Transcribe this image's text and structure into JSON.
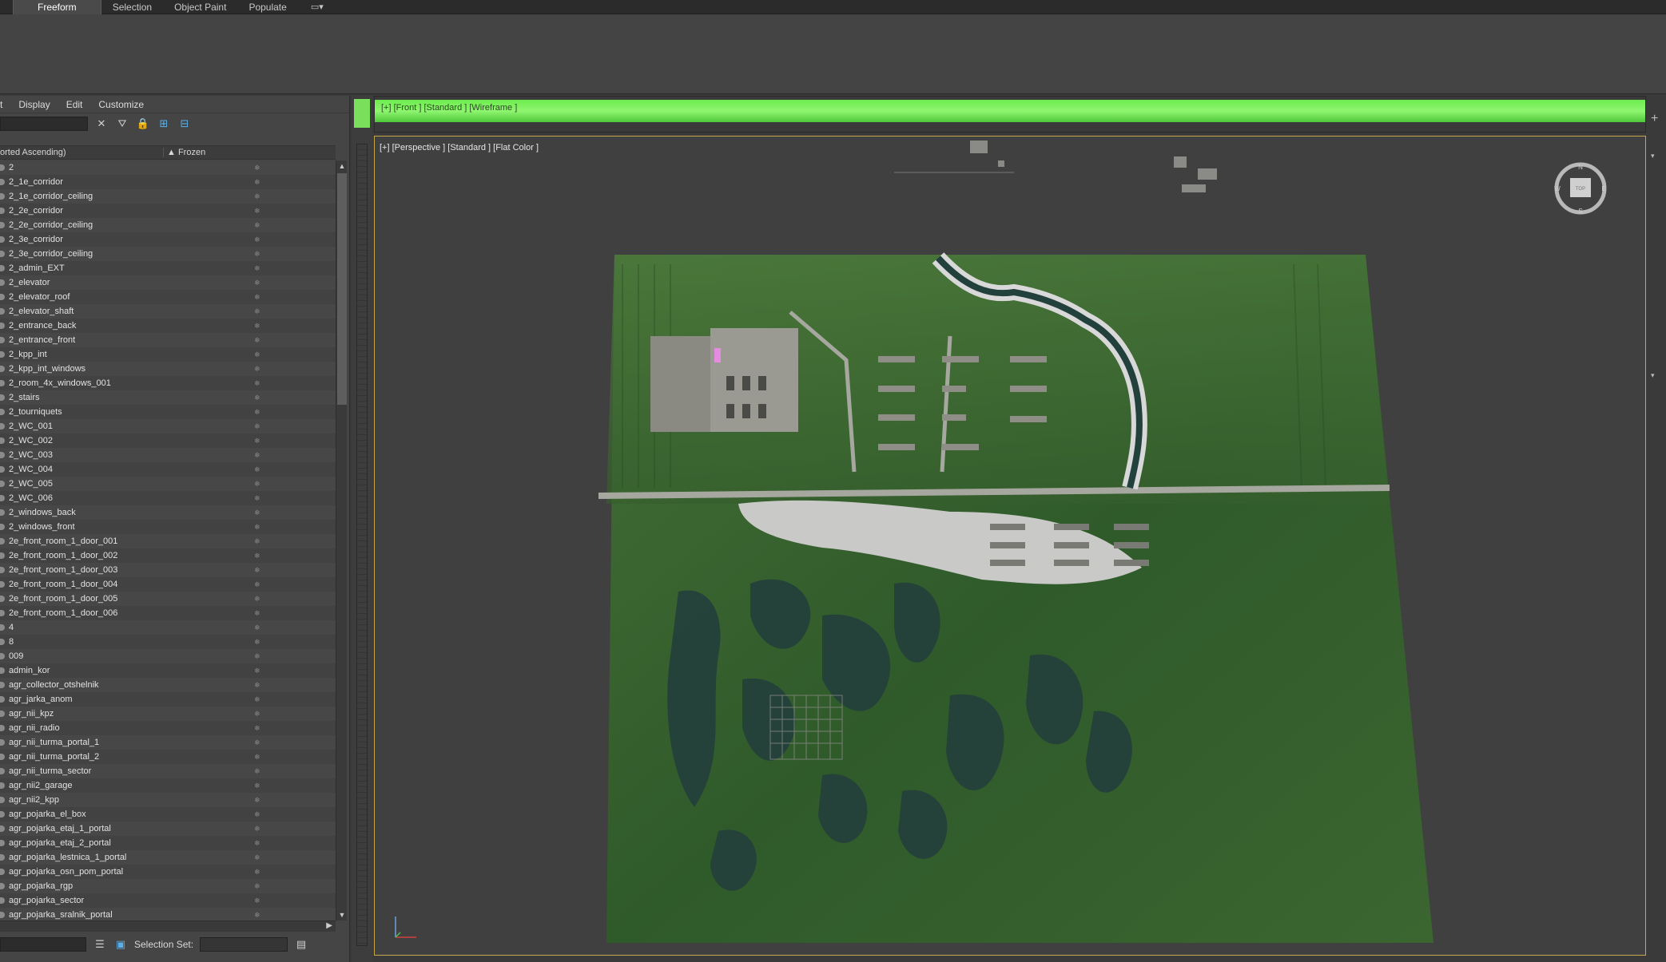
{
  "ribbon": {
    "tabs": [
      "Freeform",
      "Selection",
      "Object Paint",
      "Populate"
    ],
    "extra_icon": "camera-dropdown-icon"
  },
  "scene_explorer": {
    "menu": [
      "t",
      "Display",
      "Edit",
      "Customize"
    ],
    "column_name_header": "orted Ascending)",
    "column_frozen_header": "Frozen",
    "items": [
      "2",
      "2_1e_corridor",
      "2_1e_corridor_ceiling",
      "2_2e_corridor",
      "2_2e_corridor_ceiling",
      "2_3e_corridor",
      "2_3e_corridor_ceiling",
      "2_admin_EXT",
      "2_elevator",
      "2_elevator_roof",
      "2_elevator_shaft",
      "2_entrance_back",
      "2_entrance_front",
      "2_kpp_int",
      "2_kpp_int_windows",
      "2_room_4x_windows_001",
      "2_stairs",
      "2_tourniquets",
      "2_WC_001",
      "2_WC_002",
      "2_WC_003",
      "2_WC_004",
      "2_WC_005",
      "2_WC_006",
      "2_windows_back",
      "2_windows_front",
      "2e_front_room_1_door_001",
      "2e_front_room_1_door_002",
      "2e_front_room_1_door_003",
      "2e_front_room_1_door_004",
      "2e_front_room_1_door_005",
      "2e_front_room_1_door_006",
      "4",
      "8",
      "009",
      "admin_kor",
      "agr_collector_otshelnik",
      "agr_jarka_anom",
      "agr_nii_kpz",
      "agr_nii_radio",
      "agr_nii_turma_portal_1",
      "agr_nii_turma_portal_2",
      "agr_nii_turma_sector",
      "agr_nii2_garage",
      "agr_nii2_kpp",
      "agr_pojarka_el_box",
      "agr_pojarka_etaj_1_portal",
      "agr_pojarka_etaj_2_portal",
      "agr_pojarka_lestnica_1_portal",
      "agr_pojarka_osn_pom_portal",
      "agr_pojarka_rgp",
      "agr_pojarka_sector",
      "agr_pojarka_sralnik_portal"
    ],
    "selection_set_label": "Selection Set:"
  },
  "viewports": {
    "front_label": "[+] [Front ] [Standard ] [Wireframe ]",
    "perspective_label": "[+] [Perspective ] [Standard ] [Flat Color ]"
  },
  "viewcube": {
    "n": "N",
    "s": "S",
    "e": "E",
    "w": "W",
    "face": "TOP"
  },
  "colors": {
    "accent_green": "#7adf5a",
    "viewport_border": "#c8a64a",
    "terrain_green": "#3f6b32",
    "water": "#24403c"
  }
}
